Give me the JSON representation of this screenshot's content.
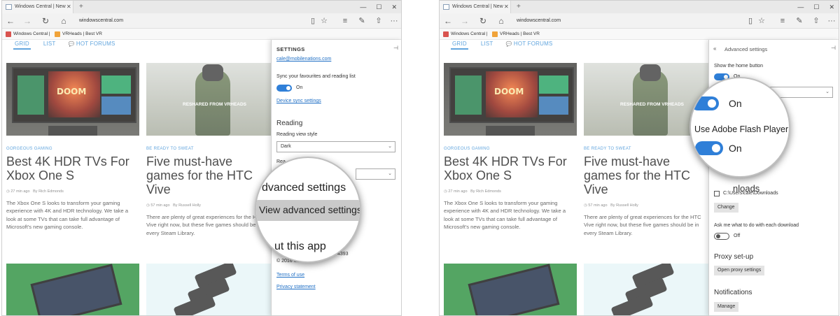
{
  "browser": {
    "tab_title": "Windows Central | New",
    "tab_close": "✕",
    "new_tab": "+",
    "url": "windowscentral.com",
    "window_controls": [
      "—",
      "☐",
      "✕"
    ],
    "nav_icons": {
      "back": "←",
      "forward": "→",
      "refresh": "↻",
      "home": "⌂"
    },
    "toolbar_icons": {
      "reading_view": "▯",
      "favourite": "☆",
      "hub": "≡",
      "notes": "✎",
      "share": "⇧",
      "more": "···"
    },
    "favourites": [
      {
        "label": "Windows Central |",
        "color": "#d9534f"
      },
      {
        "label": "VRHeads | Best VR",
        "color": "#f0a33a"
      }
    ]
  },
  "page": {
    "tabs": [
      "GRID",
      "LIST",
      "HOT FORUMS"
    ],
    "hot_forums_icon": "💬",
    "articles": [
      {
        "category": "GORGEOUS GAMING",
        "title": "Best 4K HDR TVs For Xbox One S",
        "meta_time": "27 min ago",
        "meta_author": "By Rich Edmonds",
        "excerpt": "The Xbox One S looks to transform your gaming experience with 4K and HDR technology. We take a look at some TVs that can take full advantage of Microsoft's new gaming console.",
        "thumb_label": "DOOM"
      },
      {
        "category": "BE READY TO SWEAT",
        "title": "Five must-have games for the HTC Vive",
        "meta_time": "57 min ago",
        "meta_author": "By Russell Holly",
        "excerpt": "There are plenty of great experiences for the HTC Vive right now, but these five games should be in every Steam Library.",
        "thumb_label": "RESHARED FROM VRHEADS"
      }
    ]
  },
  "settings_left": {
    "title": "SETTINGS",
    "pin_icon": "⊣",
    "account_email": "cale@mobilenations.com",
    "sync_label": "Sync your favourites and reading list",
    "sync_state": "On",
    "device_sync_link": "Device sync settings",
    "reading_header": "Reading",
    "reading_style_label": "Reading view style",
    "reading_style_value": "Dark",
    "reading_font_label": "Rea",
    "about_partial": "© 2016 Mi",
    "build": "4393",
    "terms_link": "Terms of use",
    "privacy_link": "Privacy statement"
  },
  "magnifier_left": {
    "line1": "dvanced settings",
    "line2": "View advanced settings",
    "line3": "ut this app"
  },
  "settings_right": {
    "back_icon": "«",
    "title": "Advanced settings",
    "pin_icon": "⊣",
    "home_button_label": "Show the home button",
    "home_button_state": "On",
    "downloads_partial": "nloads",
    "downloads_path": "C:\\Users\\cale\\Downloads",
    "change_button": "Change",
    "ask_download_label": "Ask me what to do with each download",
    "ask_download_state": "Off",
    "proxy_header": "Proxy set-up",
    "proxy_button": "Open proxy settings",
    "notifications_header": "Notifications",
    "manage_button": "Manage"
  },
  "magnifier_right": {
    "toggle1_state": "On",
    "flash_label": "Use Adobe Flash Player",
    "toggle2_state": "On"
  },
  "colors": {
    "accent": "#2f7fd8",
    "link": "#1f6fc5",
    "category": "#3a8fd6"
  }
}
